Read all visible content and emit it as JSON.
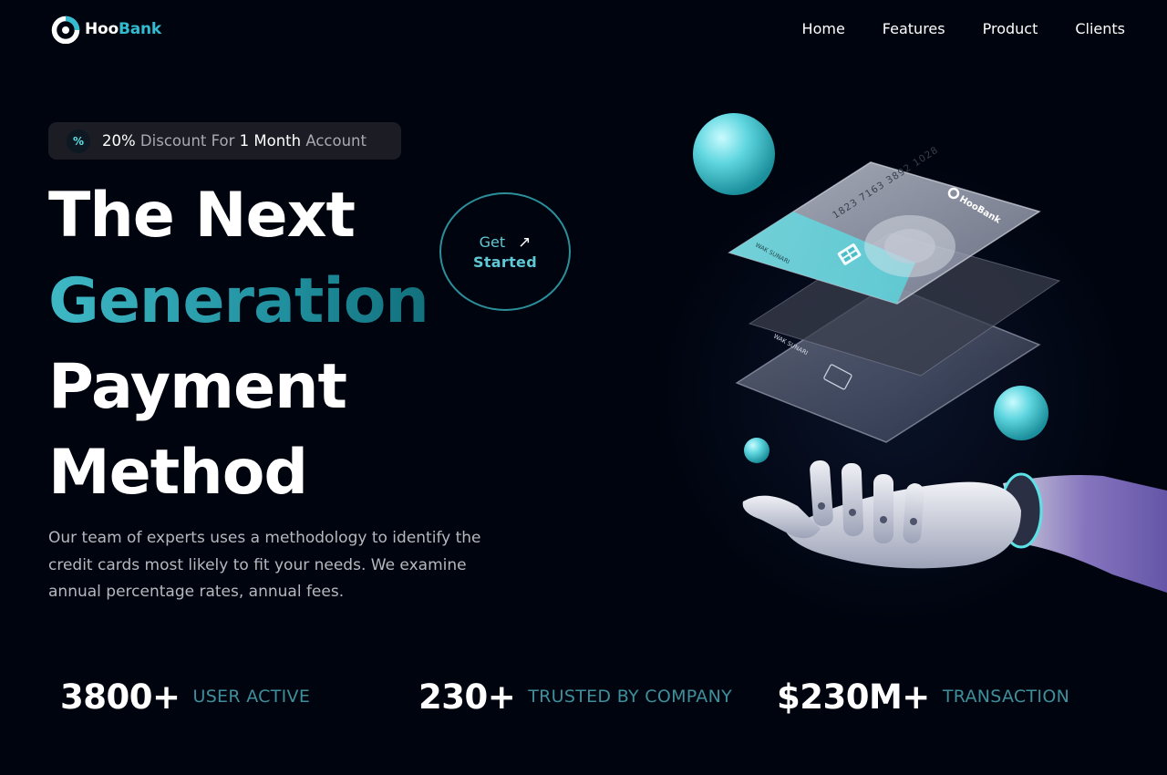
{
  "brand": {
    "name_part1": "Hoo",
    "name_part2": "Bank",
    "accent": "#33bbcf"
  },
  "nav": {
    "links": [
      "Home",
      "Features",
      "Product",
      "Clients"
    ]
  },
  "discount": {
    "icon": "percent-icon",
    "pct": "20%",
    "text1": " Discount For ",
    "months": "1 Month",
    "text2": " Account"
  },
  "headline": {
    "line1": "The Next",
    "line2": "Generation",
    "line3": "Payment",
    "line4": "Method"
  },
  "cta": {
    "word1": "Get",
    "word2": "Started",
    "icon": "arrow-up-right-icon"
  },
  "description": "Our team of experts uses a methodology to identify the credit cards most likely to fit your needs. We examine annual percentage rates, annual fees.",
  "hero_card": {
    "number": "1823 7163 3892 1028",
    "holder": "WAK SUNARI",
    "brand": "HooBank"
  },
  "stats": [
    {
      "value": "3800+",
      "label": "USER ACTIVE"
    },
    {
      "value": "230+",
      "label": "TRUSTED BY COMPANY"
    },
    {
      "value": "$230M+",
      "label": "TRANSACTION"
    }
  ],
  "colors": {
    "background": "#00040f",
    "teal": "#5ce1e6",
    "gradient_dark": "#12707c"
  }
}
